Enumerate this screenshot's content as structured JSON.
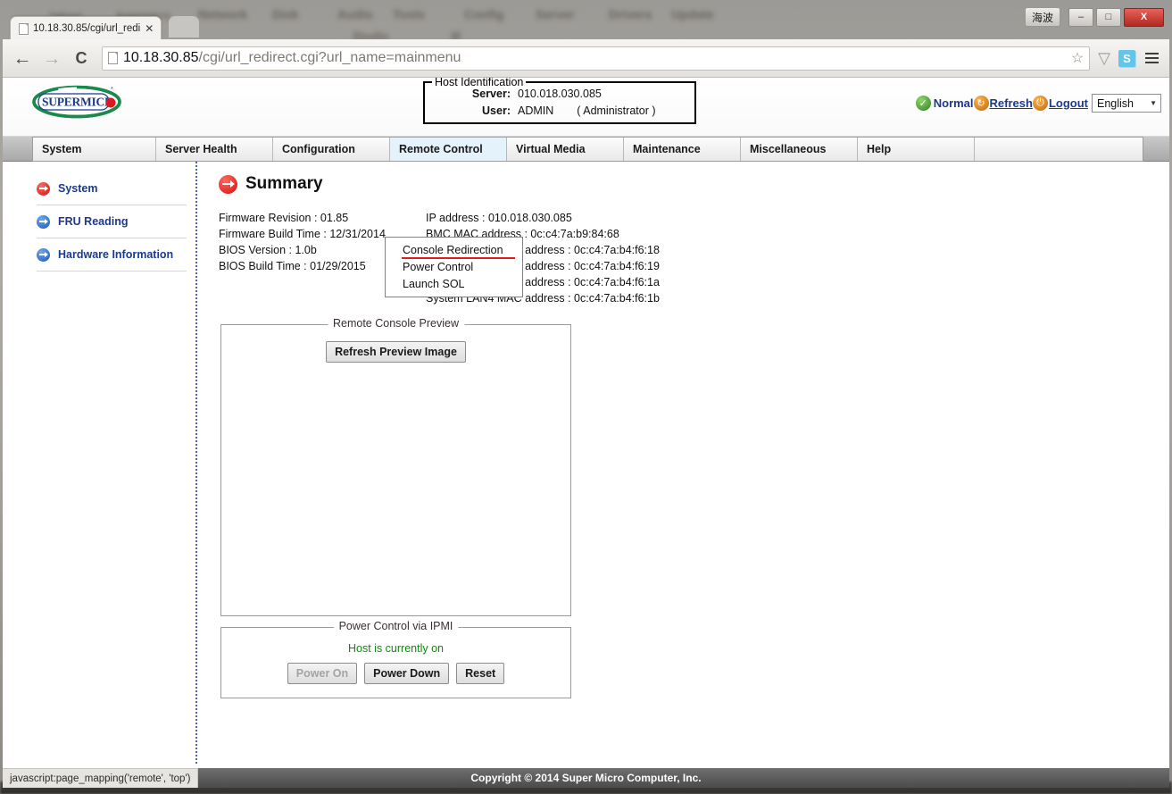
{
  "desktop": {
    "blurred_words": [
      "Yahoo!",
      "Supermicro",
      "Network",
      "Disk",
      "Audio",
      "Tools",
      "Config",
      "Server",
      "Drivers",
      "Update",
      "Console",
      "Studio",
      "Media",
      "IE"
    ]
  },
  "browser": {
    "tab": {
      "title": "10.18.30.85/cgi/url_redi",
      "close_label": "✕",
      "favicon": "page-icon"
    },
    "new_tab_label": "",
    "window_controls": {
      "ime": "海波",
      "minimize": "–",
      "maximize": "□",
      "close": "X"
    },
    "toolbar": {
      "back": "←",
      "forward": "→",
      "reload": "C",
      "url_host": "10.18.30.85",
      "url_path": "/cgi/url_redirect.cgi?url_name=mainmenu",
      "bookmark": "☆",
      "shield": "▽",
      "extension_s": "S",
      "menu": "menu-icon"
    },
    "status_bar_text": "javascript:page_mapping('remote', 'top')"
  },
  "ipmi": {
    "logo_text": "SUPERMICRO",
    "host_identification": {
      "legend": "Host Identification",
      "server_label": "Server:",
      "server_value": "010.018.030.085",
      "user_label": "User:",
      "user_value": "ADMIN",
      "user_role": "( Administrator )"
    },
    "header_right": {
      "status_label": "Normal",
      "refresh_label": "Refresh",
      "logout_label": "Logout",
      "language_value": "English",
      "language_caret": "▼"
    },
    "nav_tabs": [
      {
        "label": "System",
        "active": false
      },
      {
        "label": "Server Health",
        "active": false
      },
      {
        "label": "Configuration",
        "active": false
      },
      {
        "label": "Remote Control",
        "active": true
      },
      {
        "label": "Virtual Media",
        "active": false
      },
      {
        "label": "Maintenance",
        "active": false
      },
      {
        "label": "Miscellaneous",
        "active": false
      },
      {
        "label": "Help",
        "active": false
      }
    ],
    "dropdown": {
      "items": [
        {
          "label": "Console Redirection",
          "highlighted": true
        },
        {
          "label": "Power Control",
          "highlighted": false
        },
        {
          "label": "Launch SOL",
          "highlighted": false
        }
      ]
    },
    "sidebar": {
      "items": [
        {
          "label": "System",
          "icon": "arrow-circle-red",
          "active": true
        },
        {
          "label": "FRU Reading",
          "icon": "arrow-circle-blue",
          "active": false
        },
        {
          "label": "Hardware Information",
          "icon": "arrow-circle-blue",
          "active": false
        }
      ]
    },
    "summary": {
      "title": "Summary",
      "left_info": [
        "Firmware Revision : 01.85",
        "Firmware Build Time : 12/31/2014",
        "BIOS Version : 1.0b",
        "BIOS Build Time : 01/29/2015"
      ],
      "right_info": [
        "IP address : 010.018.030.085",
        "BMC MAC address : 0c:c4:7a:b9:84:68",
        "System LAN1 MAC address : 0c:c4:7a:b4:f6:18",
        "System LAN2 MAC address : 0c:c4:7a:b4:f6:19",
        "System LAN3 MAC address : 0c:c4:7a:b4:f6:1a",
        "System LAN4 MAC address : 0c:c4:7a:b4:f6:1b"
      ]
    },
    "remote_console_preview": {
      "legend": "Remote Console Preview",
      "refresh_button": "Refresh Preview Image"
    },
    "power_control": {
      "legend": "Power Control via IPMI",
      "status_text": "Host is currently on",
      "buttons": [
        {
          "label": "Power On",
          "disabled": true
        },
        {
          "label": "Power Down",
          "disabled": false
        },
        {
          "label": "Reset",
          "disabled": false
        }
      ]
    },
    "footer": {
      "copyright": "Copyright © 2014 Super Micro Computer, Inc."
    }
  },
  "colors": {
    "accent_blue": "#1b3a8f",
    "tab_active": "#e4f2fb",
    "highlight_red": "#e31b1b",
    "status_green": "#0b8a0b"
  }
}
